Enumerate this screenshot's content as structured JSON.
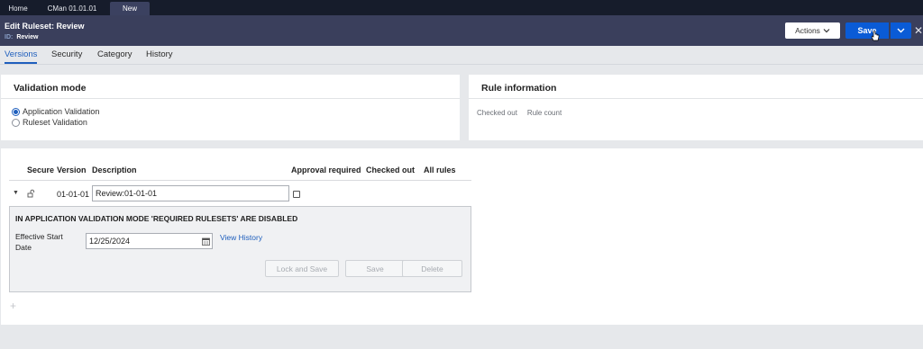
{
  "tabstrip": {
    "tabs": [
      "Home",
      "CMan 01.01.01",
      "New"
    ]
  },
  "header": {
    "title_prefix": "Edit",
    "title": "Ruleset: Review",
    "id_label": "ID:",
    "id_value": "Review",
    "actions_label": "Actions",
    "save_label": "Save",
    "primary_color": "#0a5bd6"
  },
  "subtabs": [
    "Versions",
    "Security",
    "Category",
    "History"
  ],
  "validation": {
    "title": "Validation mode",
    "options": [
      "Application Validation",
      "Ruleset Validation"
    ],
    "selected": "Application Validation"
  },
  "rule_info": {
    "title": "Rule information",
    "labels": [
      "Checked out",
      "Rule count"
    ]
  },
  "grid": {
    "headers": [
      "Secure",
      "Version",
      "Description",
      "Approval required",
      "Checked out",
      "All rules"
    ],
    "row": {
      "version": "01-01-01",
      "description": "Review:01-01-01"
    }
  },
  "detail": {
    "warning": "IN APPLICATION VALIDATION MODE 'REQUIRED RULESETS' ARE DISABLED",
    "esd_label": "Effective Start Date",
    "date_value": "12/25/2024",
    "view_history": "View History",
    "buttons": [
      "Lock and Save",
      "Save",
      "Delete"
    ]
  }
}
